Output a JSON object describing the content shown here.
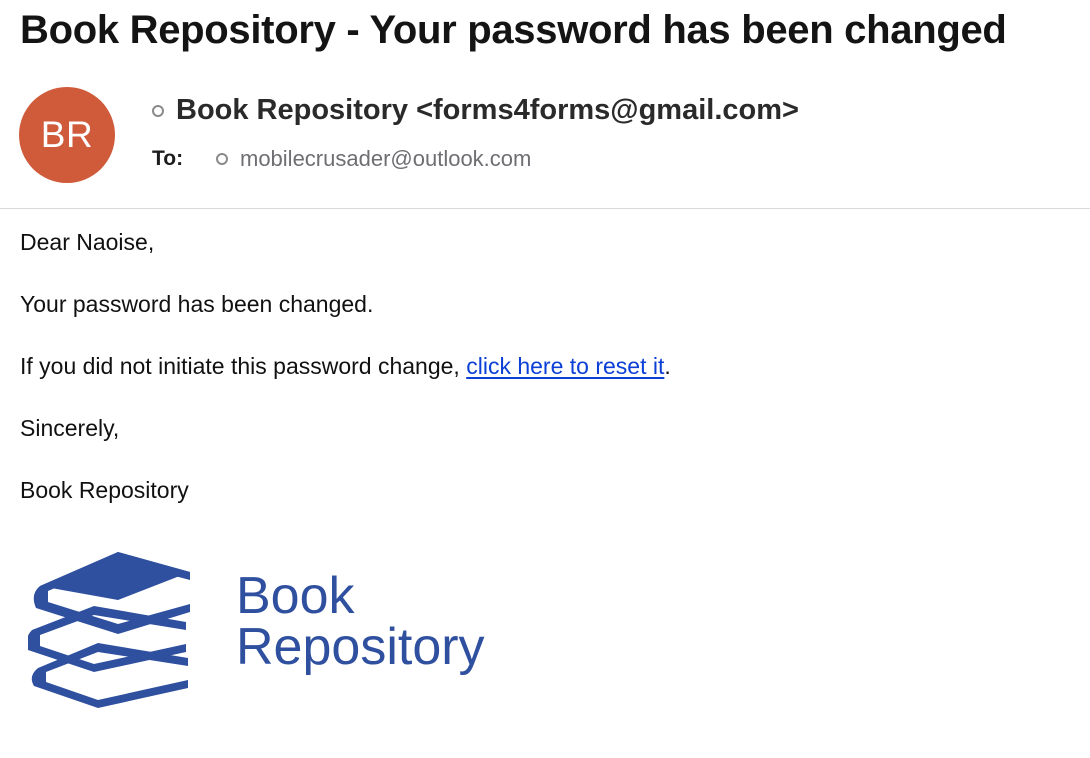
{
  "email": {
    "subject": "Book Repository - Your password has been changed",
    "avatar_initials": "BR",
    "avatar_color": "#cf5b3a",
    "from": "Book Repository <forms4forms@gmail.com>",
    "to_label": "To:",
    "to": "mobilecrusader@outlook.com"
  },
  "body": {
    "greeting": "Dear Naoise,",
    "line1": "Your password has been changed.",
    "line2_prefix": "If you did not initiate this password change, ",
    "link_text": "click here to reset it",
    "line2_suffix": ".",
    "closing": "Sincerely,",
    "signature": "Book Repository"
  },
  "logo": {
    "icon": "book-stack-icon",
    "word1": "Book",
    "word2": "Repository",
    "color": "#2f4f9f"
  },
  "colors": {
    "link": "#0b3fd6",
    "brand": "#2f4f9f"
  }
}
